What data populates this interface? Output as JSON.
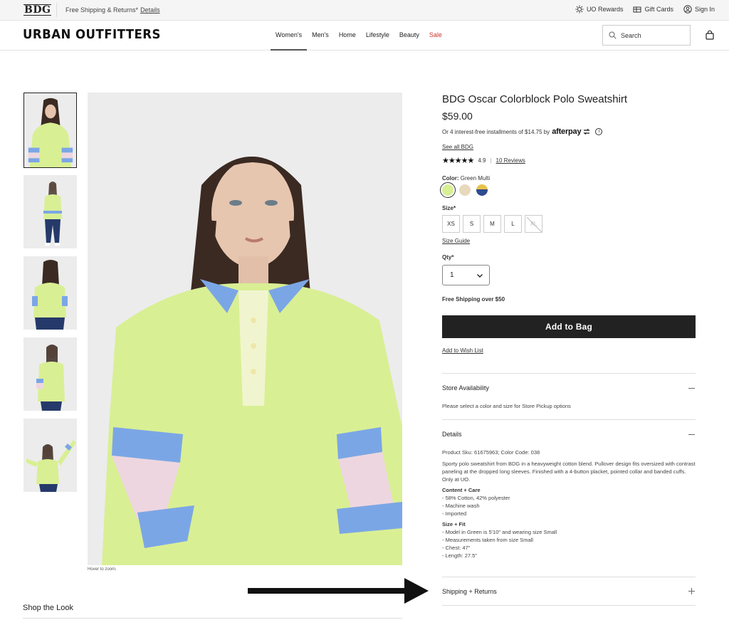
{
  "promo": {
    "logo": "BDG",
    "text": "Free Shipping & Returns*",
    "details_link": "Details",
    "rewards": "UO Rewards",
    "gift_cards": "Gift Cards",
    "sign_in": "Sign In"
  },
  "header": {
    "brand": "URBAN OUTFITTERS",
    "nav": [
      "Women's",
      "Men's",
      "Home",
      "Lifestyle",
      "Beauty",
      "Sale"
    ],
    "active_nav": "Women's",
    "search_placeholder": "Search"
  },
  "gallery": {
    "thumbnail_count": 5,
    "zoom_hint": "Hover to zoom."
  },
  "shop_the_look": "Shop the Look",
  "product": {
    "title": "BDG Oscar Colorblock Polo Sweatshirt",
    "price": "$59.00",
    "afterpay_text": "Or 4 interest-free installments of $14.75 by",
    "afterpay_brand": "afterpay",
    "see_all": "See all BDG",
    "stars": "★★★★★",
    "rating": "4.9",
    "reviews": "10 Reviews",
    "color_label": "Color:",
    "color_value": "Green Multi",
    "swatches": [
      "#d9ef94",
      "#e8d9bd",
      "#2f4b8f"
    ],
    "size_label": "Size*",
    "sizes": [
      "XS",
      "S",
      "M",
      "L",
      "XL"
    ],
    "size_guide": "Size Guide",
    "qty_label": "Qty*",
    "qty_value": "1",
    "free_shipping": "Free Shipping over $50",
    "add_to_bag": "Add to Bag",
    "wish_list": "Add to Wish List"
  },
  "accordion": {
    "store_title": "Store Availability",
    "store_text": "Please select a color and size for Store Pickup options",
    "details_title": "Details",
    "sku": "Product Sku: 61675963; Color Code: 038",
    "description": "Sporty polo sweatshirt from BDG in a heavyweight cotton blend. Pullover design fits oversized with contrast paneling at the dropped long sleeves. Finished with a 4-button placket, pointed collar and banded cuffs. Only at UO.",
    "care_heading": "Content + Care",
    "care_items": [
      "- 58% Cotton, 42% polyester",
      "- Machine wash",
      "- Imported"
    ],
    "fit_heading": "Size + Fit",
    "fit_items": [
      "- Model in Green is 5'10\" and wearing size Small",
      "- Measurements taken from size Small",
      "- Chest: 47\"",
      "- Length: 27.5\""
    ],
    "shipping_title": "Shipping + Returns"
  }
}
